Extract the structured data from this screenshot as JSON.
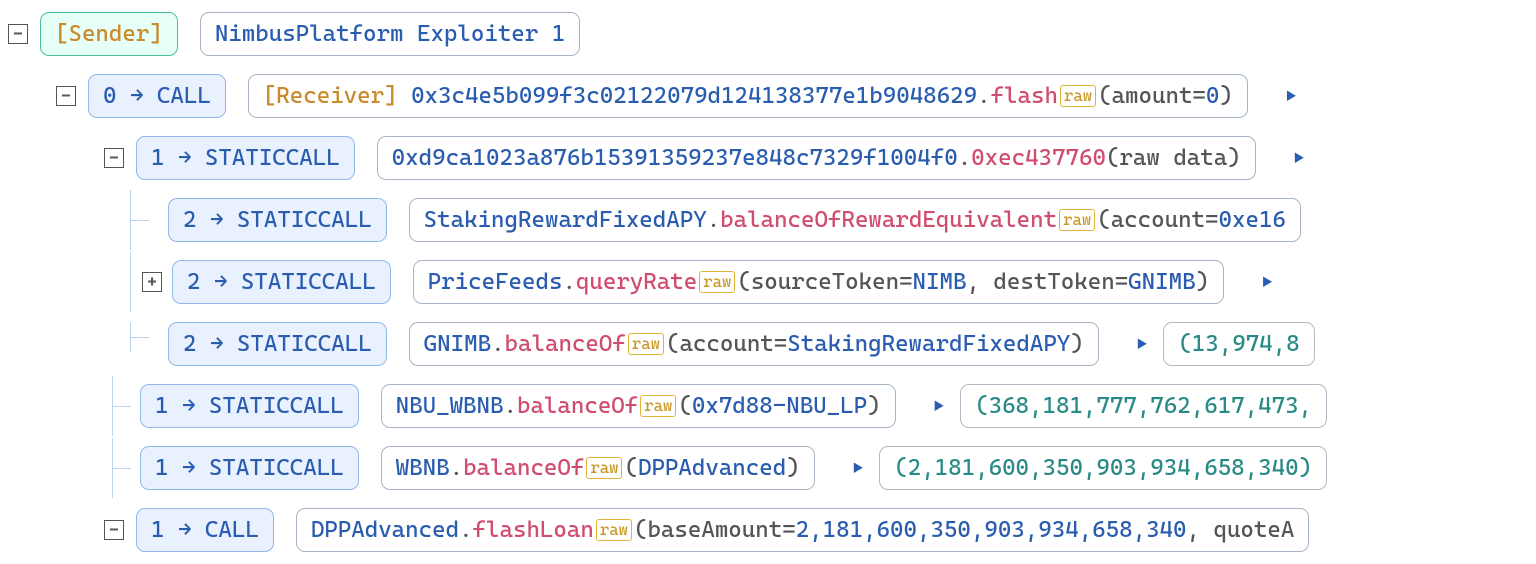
{
  "labels": {
    "sender": "[Sender]",
    "receiver": "[Receiver]",
    "raw": "raw"
  },
  "root": {
    "name": "NimbusPlatform Exploiter 1"
  },
  "rows": [
    {
      "depth_label": "0 → CALL",
      "target": "0x3c4e5b099f3c02122079d124138377e1b9048629",
      "func": "flash",
      "has_raw": true,
      "args_pre": "(amount=",
      "args_num": "0",
      "args_post": ")"
    },
    {
      "depth_label": "1 → STATICCALL",
      "target": "0xd9ca1023a876b15391359237e848c7329f1004f0",
      "func": "0xec437760",
      "args_plain": "(raw data)"
    },
    {
      "depth_label": "2 → STATICCALL",
      "target": "StakingRewardFixedAPY",
      "func": "balanceOfRewardEquivalent",
      "has_raw": true,
      "args_pre": "(account=",
      "args_val_blue": "0xe16"
    },
    {
      "depth_label": "2 → STATICCALL",
      "target": "PriceFeeds",
      "func": "queryRate",
      "has_raw": true,
      "args_pre": "(sourceToken=",
      "v1": "NIMB",
      "mid": ", destToken=",
      "v2": "GNIMB",
      "args_post": ")"
    },
    {
      "depth_label": "2 → STATICCALL",
      "target": "GNIMB",
      "func": "balanceOf",
      "has_raw": true,
      "args_pre": "(account=",
      "v1": "StakingRewardFixedAPY",
      "args_post": ")",
      "return": "(13,974,8"
    },
    {
      "depth_label": "1 → STATICCALL",
      "target": "NBU_WBNB",
      "func": "balanceOf",
      "has_raw": true,
      "args_pre": "(",
      "v1": "0x7d88-NBU_LP",
      "args_post": ")",
      "return": "(368,181,777,762,617,473,"
    },
    {
      "depth_label": "1 → STATICCALL",
      "target": "WBNB",
      "func": "balanceOf",
      "has_raw": true,
      "args_pre": "(",
      "v1": "DPPAdvanced",
      "args_post": ")",
      "return": "(2,181,600,350,903,934,658,340)"
    },
    {
      "depth_label": "1 → CALL",
      "target": "DPPAdvanced",
      "func": "flashLoan",
      "has_raw": true,
      "args_pre": "(baseAmount=",
      "args_num": "2,181,600,350,903,934,658,340",
      "args_post": ", quoteA"
    }
  ]
}
